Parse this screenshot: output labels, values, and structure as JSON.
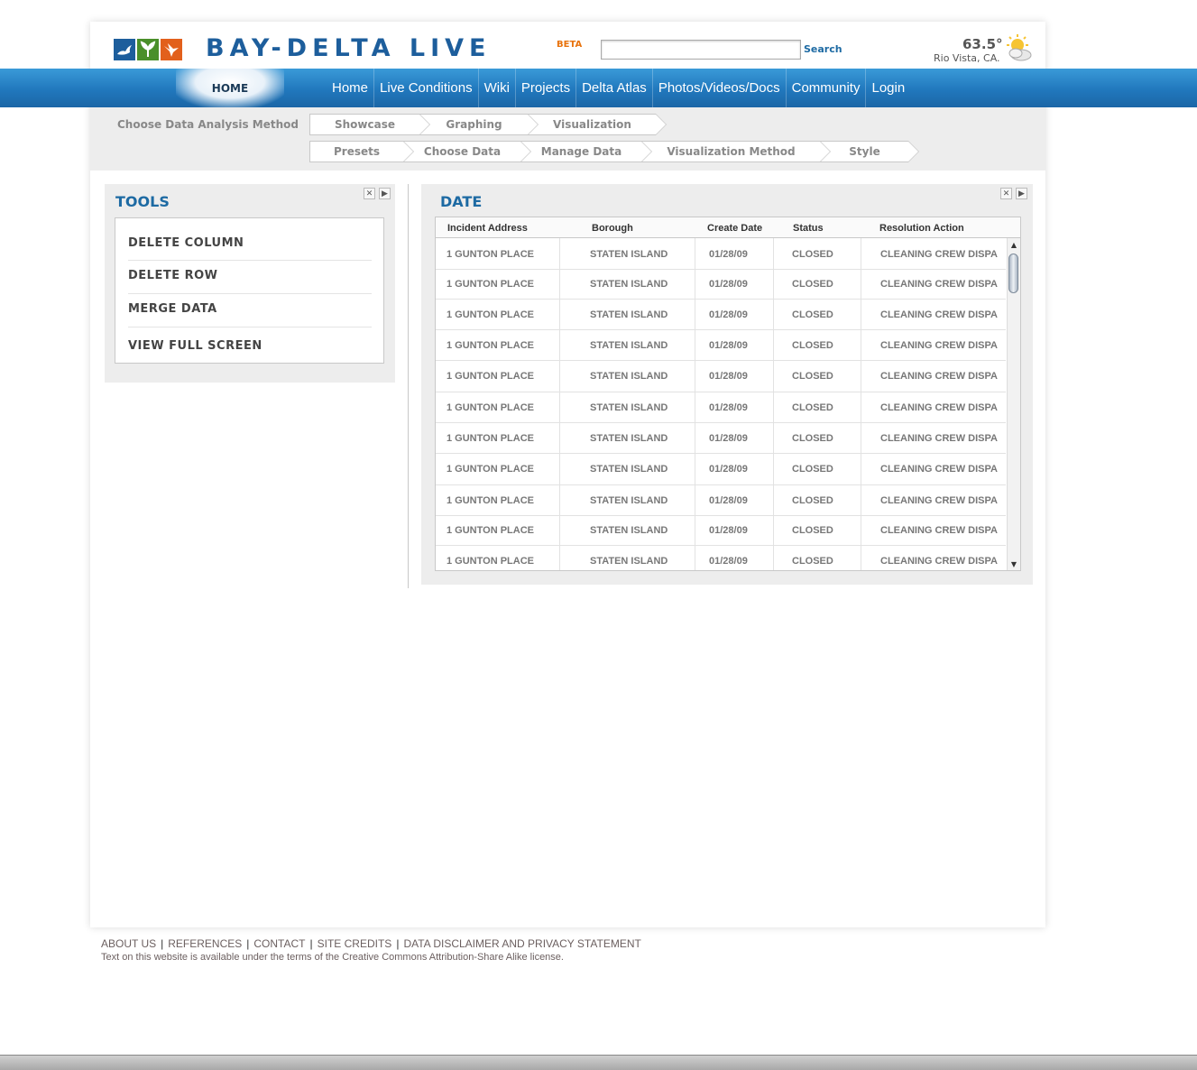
{
  "header": {
    "brand": "BAY-DELTA LIVE",
    "beta": "BETA",
    "search_placeholder": "",
    "search_label": "Search",
    "weather_temp": "63.5°",
    "weather_location": "Rio Vista, CA."
  },
  "nav": {
    "active_tab": "HOME",
    "items": [
      "Home",
      "Live Conditions",
      "Wiki",
      "Projects",
      "Delta Atlas",
      "Photos/Videos/Docs",
      "Community",
      "Login"
    ]
  },
  "steps": {
    "title": "Choose Data Analysis Method",
    "row1": [
      "Showcase",
      "Graphing",
      "Visualization"
    ],
    "row2": [
      "Presets",
      "Choose Data",
      "Manage Data",
      "Visualization Method",
      "Style"
    ]
  },
  "tools": {
    "title": "TOOLS",
    "items": [
      "DELETE COLUMN",
      "DELETE ROW",
      "MERGE DATA",
      "VIEW FULL SCREEN"
    ]
  },
  "date_panel": {
    "title": "DATE",
    "columns": [
      "Incident Address",
      "Borough",
      "Create Date",
      "Status",
      "Resolution Action"
    ],
    "rows": [
      [
        "1 GUNTON PLACE",
        "STATEN ISLAND",
        "01/28/09",
        "CLOSED",
        "CLEANING CREW DISPA"
      ],
      [
        "1 GUNTON PLACE",
        "STATEN ISLAND",
        "01/28/09",
        "CLOSED",
        "CLEANING CREW DISPA"
      ],
      [
        "1 GUNTON PLACE",
        "STATEN ISLAND",
        "01/28/09",
        "CLOSED",
        "CLEANING CREW DISPA"
      ],
      [
        "1 GUNTON PLACE",
        "STATEN ISLAND",
        "01/28/09",
        "CLOSED",
        "CLEANING CREW DISPA"
      ],
      [
        "1 GUNTON PLACE",
        "STATEN ISLAND",
        "01/28/09",
        "CLOSED",
        "CLEANING CREW DISPA"
      ],
      [
        "1 GUNTON PLACE",
        "STATEN ISLAND",
        "01/28/09",
        "CLOSED",
        "CLEANING CREW DISPA"
      ],
      [
        "1 GUNTON PLACE",
        "STATEN ISLAND",
        "01/28/09",
        "CLOSED",
        "CLEANING CREW DISPA"
      ],
      [
        "1 GUNTON PLACE",
        "STATEN ISLAND",
        "01/28/09",
        "CLOSED",
        "CLEANING CREW DISPA"
      ],
      [
        "1 GUNTON PLACE",
        "STATEN ISLAND",
        "01/28/09",
        "CLOSED",
        "CLEANING CREW DISPA"
      ],
      [
        "1 GUNTON PLACE",
        "STATEN ISLAND",
        "01/28/09",
        "CLOSED",
        "CLEANING CREW DISPA"
      ],
      [
        "1 GUNTON PLACE",
        "STATEN ISLAND",
        "01/28/09",
        "CLOSED",
        "CLEANING CREW DISPA"
      ]
    ]
  },
  "footer": {
    "links": [
      "ABOUT US",
      "REFERENCES",
      "CONTACT",
      "SITE CREDITS",
      "DATA DISCLAIMER AND PRIVACY STATEMENT"
    ],
    "note": "Text on this website is available under the terms of the Creative Commons Attribution-Share Alike license."
  },
  "colors": {
    "brand_blue": "#1d5e9c",
    "nav_blue": "#2178bd",
    "beta_orange": "#e8720c",
    "panel_title_blue": "#1d6aa3"
  }
}
